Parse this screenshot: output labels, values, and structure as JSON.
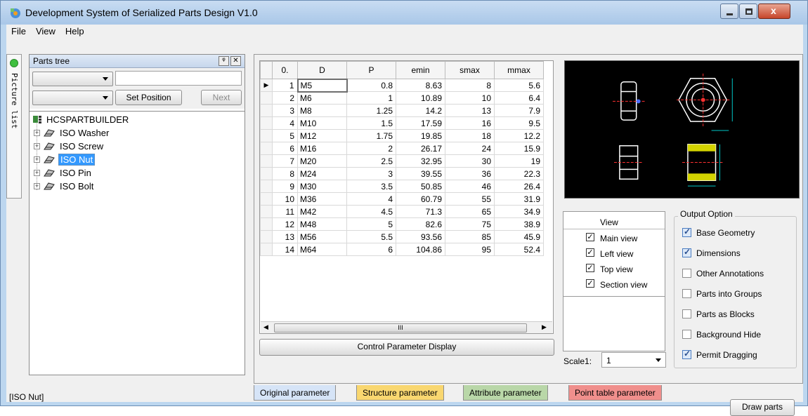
{
  "window": {
    "title": "Development System of Serialized Parts Design V1.0"
  },
  "menu": [
    "File",
    "View",
    "Help"
  ],
  "side_tab": {
    "label": "Picture list"
  },
  "parts_panel": {
    "title": "Parts tree",
    "pin_glyph": "ᵠ",
    "close_glyph": "✕",
    "set_position": "Set Position",
    "next": "Next",
    "tree": {
      "root": "HCSPARTBUILDER",
      "items": [
        "ISO Washer",
        "ISO Screw",
        "ISO Nut",
        "ISO Pin",
        "ISO Bolt"
      ],
      "selected": "ISO Nut"
    }
  },
  "grid": {
    "columns": [
      "0.",
      "D",
      "P",
      "emin",
      "smax",
      "mmax"
    ],
    "rows": [
      [
        "1",
        "M5",
        "0.8",
        "8.63",
        "8",
        "5.6"
      ],
      [
        "2",
        "M6",
        "1",
        "10.89",
        "10",
        "6.4"
      ],
      [
        "3",
        "M8",
        "1.25",
        "14.2",
        "13",
        "7.9"
      ],
      [
        "4",
        "M10",
        "1.5",
        "17.59",
        "16",
        "9.5"
      ],
      [
        "5",
        "M12",
        "1.75",
        "19.85",
        "18",
        "12.2"
      ],
      [
        "6",
        "M16",
        "2",
        "26.17",
        "24",
        "15.9"
      ],
      [
        "7",
        "M20",
        "2.5",
        "32.95",
        "30",
        "19"
      ],
      [
        "8",
        "M24",
        "3",
        "39.55",
        "36",
        "22.3"
      ],
      [
        "9",
        "M30",
        "3.5",
        "50.85",
        "46",
        "26.4"
      ],
      [
        "10",
        "M36",
        "4",
        "60.79",
        "55",
        "31.9"
      ],
      [
        "11",
        "M42",
        "4.5",
        "71.3",
        "65",
        "34.9"
      ],
      [
        "12",
        "M48",
        "5",
        "82.6",
        "75",
        "38.9"
      ],
      [
        "13",
        "M56",
        "5.5",
        "93.56",
        "85",
        "45.9"
      ],
      [
        "14",
        "M64",
        "6",
        "104.86",
        "95",
        "52.4"
      ]
    ],
    "scroll_thumb": "III"
  },
  "control_button": "Control Parameter Display",
  "views": {
    "header": "View",
    "items": [
      {
        "label": "Main view",
        "checked": true
      },
      {
        "label": "Left view",
        "checked": true
      },
      {
        "label": "Top view",
        "checked": true
      },
      {
        "label": "Section view",
        "checked": true
      }
    ]
  },
  "scale": {
    "label": "Scale1:",
    "value": "1"
  },
  "output": {
    "title": "Output Option",
    "options": [
      {
        "label": "Base Geometry",
        "checked": true
      },
      {
        "label": "Dimensions",
        "checked": true
      },
      {
        "label": "Other Annotations",
        "checked": false
      },
      {
        "label": "Parts into Groups",
        "checked": false
      },
      {
        "label": "Parts as Blocks",
        "checked": false
      },
      {
        "label": "Background Hide",
        "checked": false
      },
      {
        "label": "Permit Dragging",
        "checked": true
      }
    ]
  },
  "tabs": [
    {
      "label": "Original parameter",
      "color": "#d6e4f7"
    },
    {
      "label": "Structure parameter",
      "color": "#f9d770"
    },
    {
      "label": "Attribute parameter",
      "color": "#b9d7a8"
    },
    {
      "label": "Point table parameter",
      "color": "#f08f8c"
    }
  ],
  "draw_button": "Draw parts",
  "status": "[ISO Nut]"
}
